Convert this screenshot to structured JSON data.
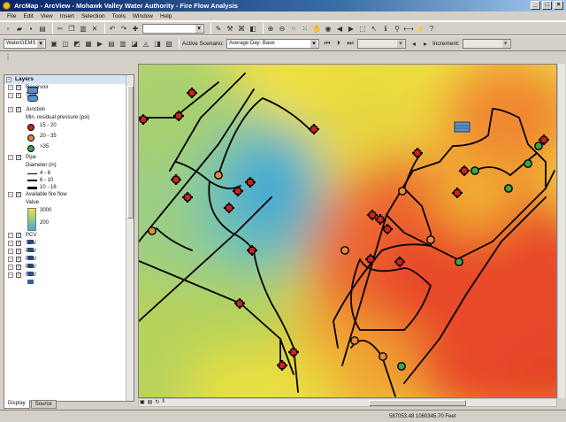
{
  "window": {
    "title": "ArcMap - ArcView - Mohawk Valley Water Authority - Fire Flow Analysis"
  },
  "menu": [
    "File",
    "Edit",
    "View",
    "Insert",
    "Selection",
    "Tools",
    "Window",
    "Help"
  ],
  "toolbar": {
    "scale_value": "",
    "watergems_label": "WaterGEMS",
    "active_scenario_label": "Active Scenario:",
    "active_scenario_value": "Average Day: Base",
    "increment_label": "Increment:"
  },
  "toc": {
    "root": "Layers",
    "items": [
      {
        "label": "Reservoir",
        "level": 0
      },
      {
        "label": "Tank",
        "level": 0
      },
      {
        "label": "Junction",
        "level": 0
      },
      {
        "label": "Min. residual pressure (psi)",
        "level": 1
      },
      {
        "label": "15 - 20",
        "level": 2
      },
      {
        "label": "20 - 35",
        "level": 2
      },
      {
        "label": ">35",
        "level": 2
      },
      {
        "label": "Pipe",
        "level": 0
      },
      {
        "label": "Diameter (in)",
        "level": 1
      },
      {
        "label": "4 - 6",
        "level": 2
      },
      {
        "label": "6 - 10",
        "level": 2
      },
      {
        "label": "10 - 16",
        "level": 2
      },
      {
        "label": "Available fire flow",
        "level": 0
      },
      {
        "label": "Value",
        "level": 1
      },
      {
        "label": "3000",
        "level": 2
      },
      {
        "label": "200",
        "level": 2
      },
      {
        "label": "PCV",
        "level": 0
      },
      {
        "label": "SPV",
        "level": 0
      },
      {
        "label": "PSV",
        "level": 0
      },
      {
        "label": "PRV",
        "level": 0
      },
      {
        "label": "PBV",
        "level": 0
      },
      {
        "label": "FCV",
        "level": 0
      }
    ],
    "tabs": [
      "Display",
      "Source"
    ]
  },
  "status": {
    "coordinates": "587053.48  1060345.70 Feet"
  },
  "colors": {
    "fire_flow_high": "#3fa7d6",
    "fire_flow_low": "#e8452c",
    "junction_low": "#d0211c",
    "junction_mid": "#e28c3a",
    "junction_high": "#3aa64a",
    "pipe": "#000000",
    "tank": "#5b8fc7"
  }
}
